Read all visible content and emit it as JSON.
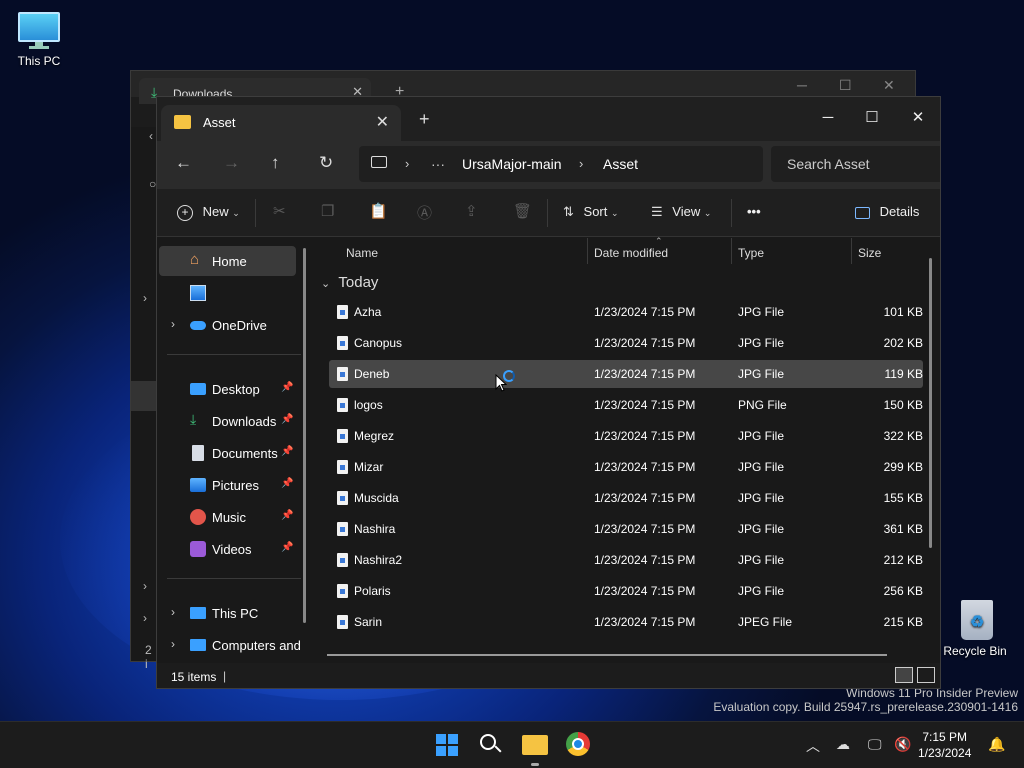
{
  "desktop": {
    "this_pc_label": "This PC",
    "recycle_bin_label": "Recycle Bin",
    "watermark_line1": "Windows 11 Pro Insider Preview",
    "watermark_line2": "Evaluation copy. Build 25947.rs_prerelease.230901-1416"
  },
  "back_window": {
    "tab_label": "Downloads",
    "status_fragment": "2 i"
  },
  "window": {
    "tab_label": "Asset",
    "breadcrumb": [
      "UrsaMajor-main",
      "Asset"
    ],
    "search_placeholder": "Search Asset",
    "toolbar": {
      "new_label": "New",
      "sort_label": "Sort",
      "view_label": "View",
      "more_label": "•••",
      "details_label": "Details"
    },
    "nav": {
      "home": "Home",
      "onedrive": "OneDrive",
      "desktop": "Desktop",
      "downloads": "Downloads",
      "documents": "Documents",
      "pictures": "Pictures",
      "music": "Music",
      "videos": "Videos",
      "this_pc": "This PC",
      "computers": "Computers and"
    },
    "columns": {
      "name": "Name",
      "date": "Date modified",
      "type": "Type",
      "size": "Size"
    },
    "group_label": "Today",
    "files": [
      {
        "name": "Azha",
        "date": "1/23/2024 7:15 PM",
        "type": "JPG File",
        "size": "101 KB"
      },
      {
        "name": "Canopus",
        "date": "1/23/2024 7:15 PM",
        "type": "JPG File",
        "size": "202 KB"
      },
      {
        "name": "Deneb",
        "date": "1/23/2024 7:15 PM",
        "type": "JPG File",
        "size": "119 KB"
      },
      {
        "name": "logos",
        "date": "1/23/2024 7:15 PM",
        "type": "PNG File",
        "size": "150 KB"
      },
      {
        "name": "Megrez",
        "date": "1/23/2024 7:15 PM",
        "type": "JPG File",
        "size": "322 KB"
      },
      {
        "name": "Mizar",
        "date": "1/23/2024 7:15 PM",
        "type": "JPG File",
        "size": "299 KB"
      },
      {
        "name": "Muscida",
        "date": "1/23/2024 7:15 PM",
        "type": "JPG File",
        "size": "155 KB"
      },
      {
        "name": "Nashira",
        "date": "1/23/2024 7:15 PM",
        "type": "JPG File",
        "size": "361 KB"
      },
      {
        "name": "Nashira2",
        "date": "1/23/2024 7:15 PM",
        "type": "JPG File",
        "size": "212 KB"
      },
      {
        "name": "Polaris",
        "date": "1/23/2024 7:15 PM",
        "type": "JPG File",
        "size": "256 KB"
      },
      {
        "name": "Sarin",
        "date": "1/23/2024 7:15 PM",
        "type": "JPEG File",
        "size": "215 KB"
      }
    ],
    "selected_file": "Deneb",
    "status_count": "15 items"
  },
  "taskbar": {
    "time": "7:15 PM",
    "date": "1/23/2024"
  },
  "colors": {
    "accent": "#3a78d6",
    "folder": "#f5c342",
    "selection": "#474747"
  }
}
